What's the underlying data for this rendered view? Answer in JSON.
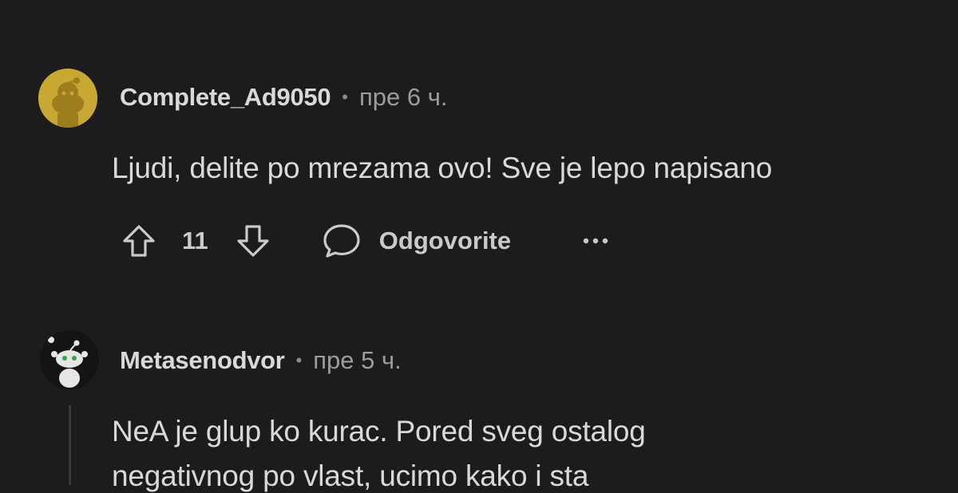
{
  "comments": [
    {
      "username": "Complete_Ad9050",
      "separator": "•",
      "time": "пре 6 ч.",
      "text": "Ljudi, delite po mrezama ovo! Sve je lepo napisano",
      "score": "11",
      "reply_label": "Odgovorite",
      "avatar_color": "#c8a832"
    },
    {
      "username": "Metasenodvor",
      "separator": "•",
      "time": "пре 5 ч.",
      "text_lines": [
        "NeA je glup ko kurac. Pored sveg ostalog",
        "negativnog po vlast, ucimo kako i sta"
      ],
      "avatar_color": "#1a1a1a"
    }
  ],
  "icons": {
    "upvote": "upvote-arrow-icon",
    "downvote": "downvote-arrow-icon",
    "reply": "speech-bubble-icon",
    "more": "more-options-icon"
  },
  "colors": {
    "background": "#1c1c1c",
    "text": "#d7dadc",
    "muted": "#9a9c9e"
  }
}
